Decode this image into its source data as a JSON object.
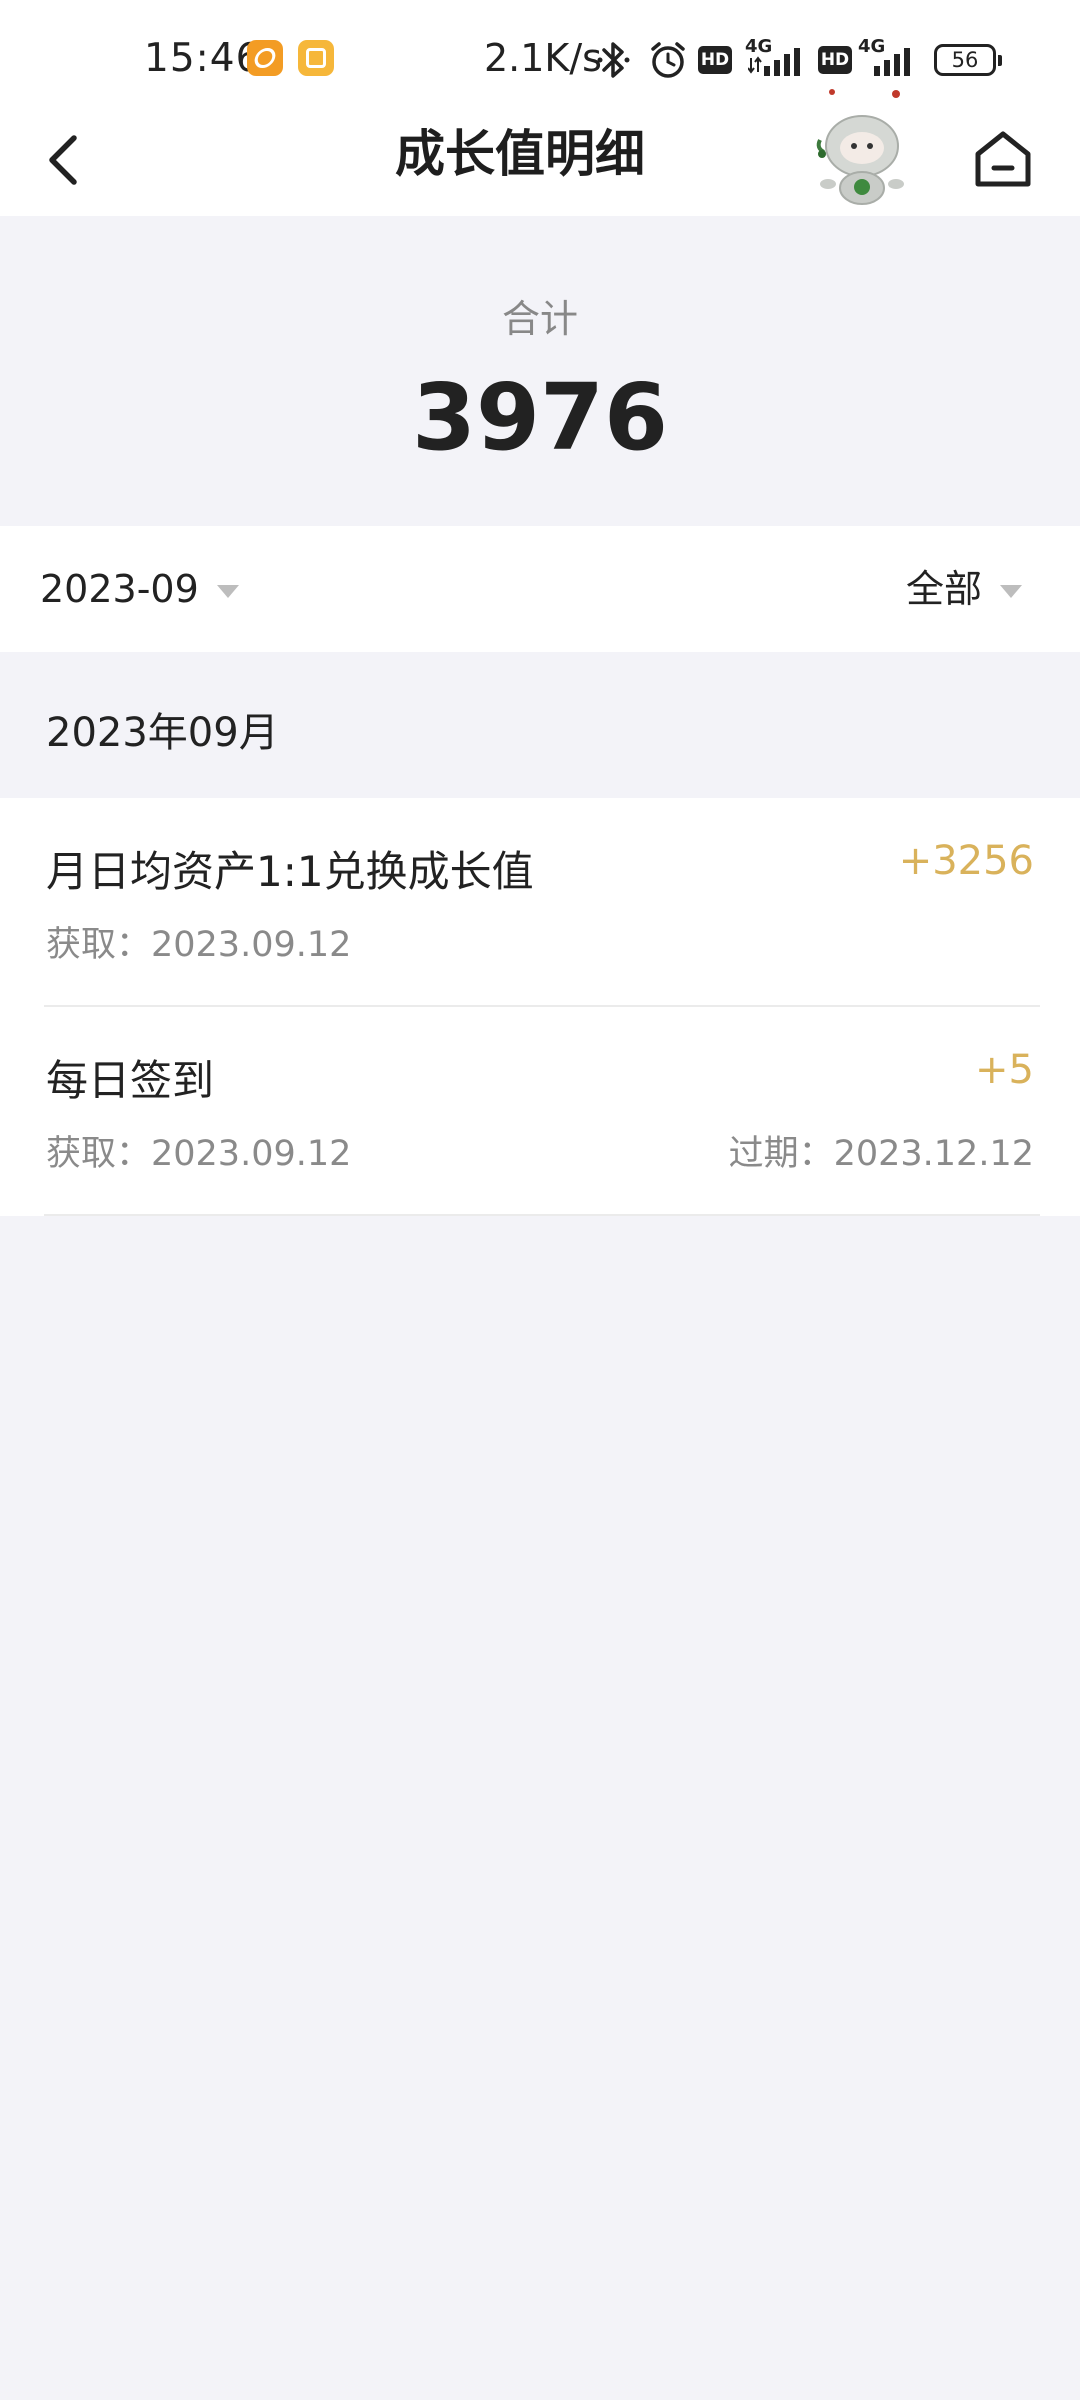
{
  "status_bar": {
    "time": "15:46",
    "network_speed": "2.1K/s",
    "network_type_1": "4G",
    "network_type_2": "4G",
    "hd_label": "HD",
    "battery": "56",
    "icons": [
      "app-notification-icon",
      "app-notification-icon-2",
      "bluetooth-icon",
      "alarm-icon",
      "hd-icon",
      "signal-icon",
      "battery-icon"
    ]
  },
  "nav": {
    "title": "成长值明细",
    "back_icon": "chevron-left-icon",
    "mascot_icon": "mascot-icon",
    "home_icon": "home-icon"
  },
  "summary": {
    "label": "合计",
    "value": "3976"
  },
  "filters": {
    "month": "2023-09",
    "type": "全部"
  },
  "section": {
    "title": "2023年09月"
  },
  "records": [
    {
      "title": "月日均资产1:1兑换成长值",
      "amount": "+3256",
      "obtained": "获取：2023.09.12",
      "expires": ""
    },
    {
      "title": "每日签到",
      "amount": "+5",
      "obtained": "获取：2023.09.12",
      "expires": "过期：2023.12.12"
    }
  ],
  "colors": {
    "accent_amount": "#d9b25b",
    "page_background": "#f3f3f8"
  }
}
